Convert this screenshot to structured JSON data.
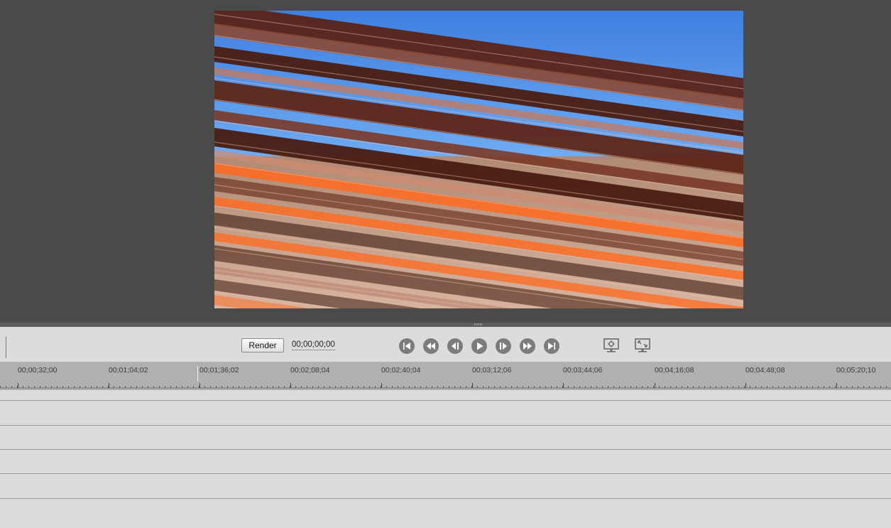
{
  "preview": {
    "colors": {
      "sky": "#4f8fe6",
      "bar_dark": "#5a2418",
      "bar_mid": "#8c4a35",
      "orange": "#ff6a1e",
      "sand": "#c9a591"
    }
  },
  "controls": {
    "render_label": "Render",
    "timecode": "00;00;00;00",
    "transport_icons": [
      "go-to-start-icon",
      "previous-edit-icon",
      "step-back-icon",
      "play-icon",
      "step-forward-icon",
      "next-edit-icon",
      "go-to-end-icon"
    ],
    "monitor_icons": [
      "monitor-settings-icon",
      "fullscreen-monitor-icon"
    ]
  },
  "ruler": {
    "labels": [
      "00;00;32;00",
      "00;01;04;02",
      "00;01;36;02",
      "00;02;08;04",
      "00;02;40;04",
      "00;03;12;06",
      "00;03;44;06",
      "00;04;16;08",
      "00;04;48;08",
      "00;05;20;10"
    ]
  },
  "tracks": {
    "count": 5
  },
  "colors": {
    "panel": "#dcdcdc",
    "monitor_bg": "#4a4a4a",
    "ruler_bg": "#b0b0b0",
    "button_icon": "#7c7c7c"
  }
}
